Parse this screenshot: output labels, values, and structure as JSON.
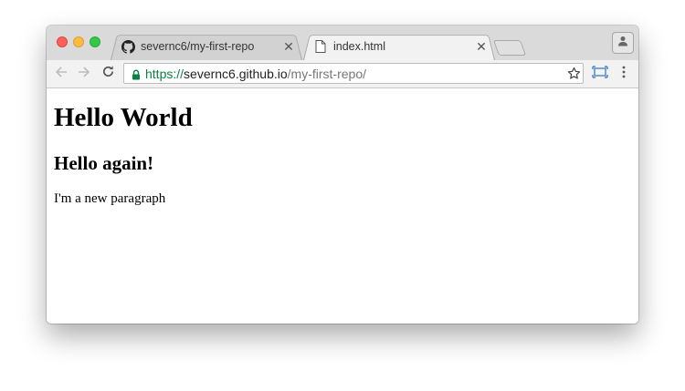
{
  "tabs": [
    {
      "title": "severnc6/my-first-repo",
      "icon": "github-icon",
      "active": false
    },
    {
      "title": "index.html",
      "icon": "document-icon",
      "active": true
    }
  ],
  "address_bar": {
    "scheme": "https://",
    "host": "severnc6.github.io",
    "path": "/my-first-repo/"
  },
  "page": {
    "heading1": "Hello World",
    "heading2": "Hello again!",
    "paragraph": "I'm a new paragraph"
  },
  "colors": {
    "secure_green": "#0b8043",
    "close": "#fc605b",
    "minimize": "#fdbc40",
    "maximize": "#34c84a"
  }
}
